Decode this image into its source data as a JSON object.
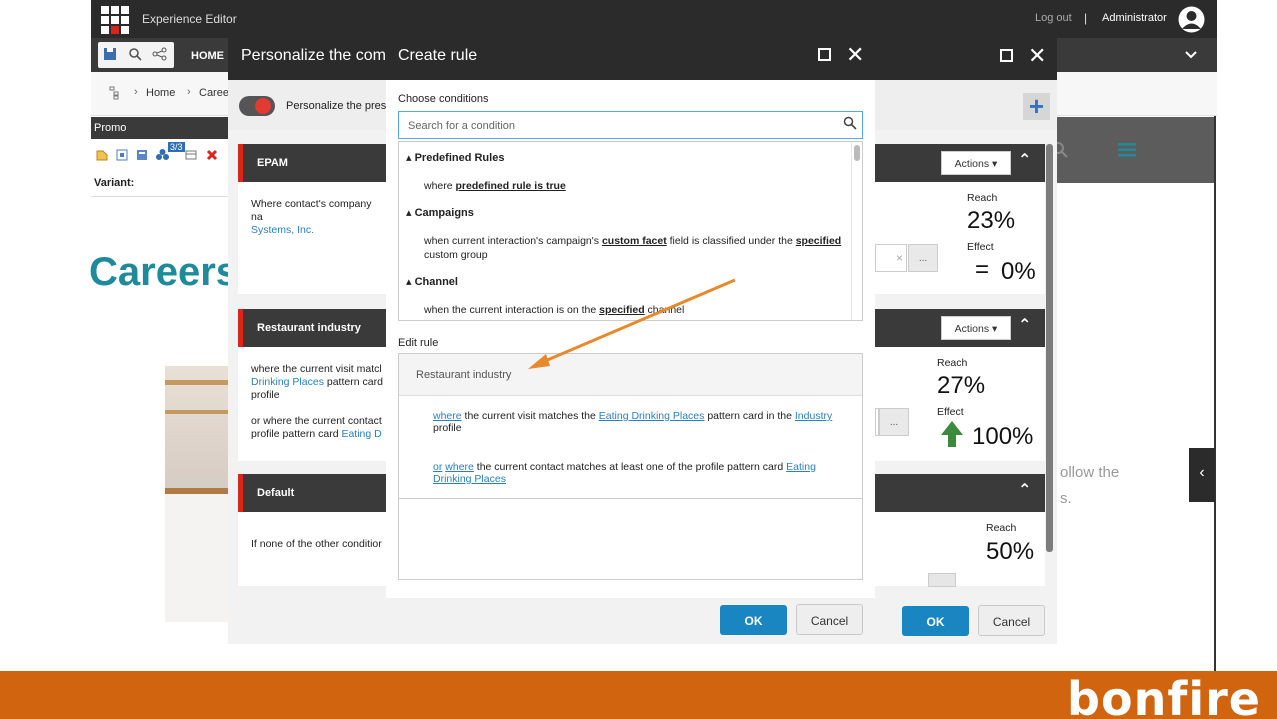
{
  "app": {
    "title": "Experience Editor",
    "logout": "Log out",
    "separator": "|",
    "user": "Administrator"
  },
  "ribbon": {
    "home_tab": "HOME"
  },
  "breadcrumb": {
    "home": "Home",
    "current": "Caree"
  },
  "component": {
    "name": "Promo",
    "variant_label": "Variant:",
    "badge": "3/3"
  },
  "page": {
    "heading": "Careers",
    "side_text_1": "ollow the",
    "side_text_2": "s."
  },
  "personalize_dialog": {
    "title": "Personalize the comp",
    "toggle_label": "Personalize the prese",
    "rules": [
      {
        "name": "EPAM",
        "text": "Where contact's company na",
        "link": "Systems, Inc.",
        "actions": "Actions",
        "reach_label": "Reach",
        "reach": "23%",
        "effect_label": "Effect",
        "effect_sign": "=",
        "effect": "0%"
      },
      {
        "name": "Restaurant industry",
        "text1": "where the current visit matcl",
        "link1": "Drinking Places",
        "text1b": " pattern card",
        "text1c": "profile",
        "text2": "or where the current contact",
        "text2b": "profile pattern card ",
        "link2": "Eating D",
        "actions": "Actions",
        "reach_label": "Reach",
        "reach": "27%",
        "effect_label": "Effect",
        "effect": "100%"
      },
      {
        "name": "Default",
        "text": "If none of the other conditior",
        "reach_label": "Reach",
        "reach": "50%"
      }
    ],
    "ok": "OK",
    "cancel": "Cancel",
    "field_clear": "×",
    "field_more": "..."
  },
  "create_rule": {
    "title": "Create rule",
    "choose_conditions": "Choose conditions",
    "search_placeholder": "Search for a condition",
    "groups": [
      {
        "name": "Predefined Rules",
        "conditions": [
          {
            "pre": "where ",
            "u1": "predefined rule is true"
          }
        ]
      },
      {
        "name": "Campaigns",
        "conditions": [
          {
            "pre": "when current interaction's campaign's ",
            "u1": "custom facet",
            "mid": " field is classified under the ",
            "u2": "specified",
            "post": "custom group"
          }
        ]
      },
      {
        "name": "Channel",
        "conditions": [
          {
            "pre": "when the current interaction is on the ",
            "u1": "specified",
            "post": " channel"
          }
        ]
      }
    ],
    "edit_rule_label": "Edit rule",
    "rule_name": "Restaurant industry",
    "rule_lines": {
      "l1_where": "where",
      "l1_a": " the current visit matches the ",
      "l1_card": "Eating Drinking Places",
      "l1_b": " pattern card in the ",
      "l1_profile": "Industry",
      "l1_c": "profile",
      "l2_or": "or",
      "l2_where": "where",
      "l2_a": " the current contact matches at least one of the profile pattern card ",
      "l2_card": "Eating Drinking Places"
    },
    "ok": "OK",
    "cancel": "Cancel"
  },
  "brand": {
    "name": "bonfire",
    "color": "#d0640f"
  },
  "colors": {
    "accent_blue": "#1a86c1",
    "dark": "#2b2b2b",
    "annotation_arrow": "#e8892b"
  }
}
